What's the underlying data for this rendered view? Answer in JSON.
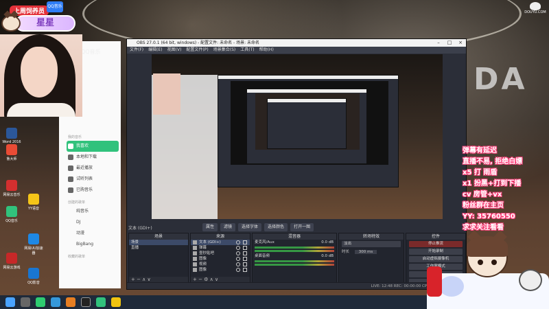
{
  "badge": {
    "top_label": "上周饲养员",
    "name": "星星",
    "qq_logo_text": "QQ音乐"
  },
  "qqmusic": {
    "app_title": "QQ音乐",
    "section_mine": "我的音乐",
    "items": [
      {
        "label": "我喜欢",
        "active": true
      },
      {
        "label": "本地和下载",
        "active": false
      },
      {
        "label": "最近播放",
        "active": false
      },
      {
        "label": "试听列表",
        "active": false
      },
      {
        "label": "已购音乐",
        "active": false
      }
    ],
    "section_created": "创建的歌单",
    "playlists": [
      "纯音乐",
      "DJ",
      "动漫",
      "BigBang"
    ],
    "section_collected": "收藏的歌单"
  },
  "desktop_icons": [
    {
      "label": "Word 2016",
      "color": "#2b579a"
    },
    {
      "label": "鲁大师",
      "color": "#e94b35"
    },
    {
      "label": "网易云音乐",
      "color": "#d32f2f"
    },
    {
      "label": "YY语音",
      "color": "#f5c518"
    },
    {
      "label": "QQ音乐",
      "color": "#31c27c"
    },
    {
      "label": "网易UU加速器",
      "color": "#1e88e5"
    },
    {
      "label": "网易云游戏",
      "color": "#c62828"
    },
    {
      "label": "QQ影音",
      "color": "#1976d2"
    }
  ],
  "obs": {
    "title": "OBS 27.0.1 (64 bit, windows) - 配置文件: 未命名 - 场景: 未命名",
    "menu": [
      "文件(F)",
      "编辑(E)",
      "视图(V)",
      "配置文件(P)",
      "场景集合(S)",
      "工具(T)",
      "帮助(H)"
    ],
    "source_label": "文本 (GDI+)",
    "toolbar": [
      "属性",
      "滤镜",
      "选择字体",
      "选择颜色",
      "打开一图"
    ],
    "docks": {
      "scenes": {
        "title": "场景",
        "items": [
          "场景",
          "直播"
        ]
      },
      "sources": {
        "title": "来源",
        "items": [
          "文本 (GDI+)",
          "弹幕",
          "壹秒贴吧",
          "图像",
          "视频",
          "图像"
        ]
      },
      "mixer": {
        "title": "混音器",
        "items": [
          "麦克风/Aux",
          "桌面音频"
        ],
        "levels": [
          "0.0 dB",
          "0.0 dB"
        ]
      },
      "transitions": {
        "title": "转场特效",
        "type": "淡出",
        "duration_label": "时长",
        "duration": "300 ms"
      },
      "controls": {
        "title": "控件",
        "buttons": [
          "停止推流",
          "开始录制",
          "启动虚拟摄像机",
          "工作室模式",
          "设置",
          "退出"
        ]
      }
    },
    "status": "LIVE: 12:48  REC: 00:00:00  CPU: 1.7%, 60.00 fps"
  },
  "overlay": {
    "lines": [
      "弹幕有延迟",
      "直播不易, 拒绝白嫖",
      "x5 打 雨盾",
      "x1 扮黑+打到下播",
      "cv 房管+vx",
      "粉丝群在主页",
      "YY: 35760550",
      "求求关注看看"
    ]
  },
  "douyu": {
    "label": "DOUYU.COM"
  },
  "colors": {
    "qq_green": "#31c27c",
    "obs_bg": "#2b2e38",
    "badge_red": "#e3323a",
    "overlay_outline": "#ff3c78"
  }
}
